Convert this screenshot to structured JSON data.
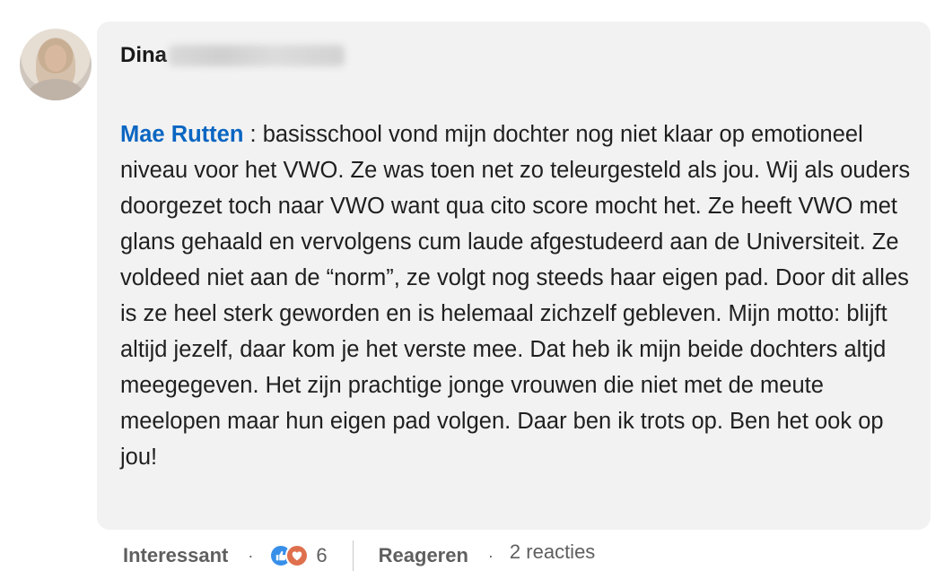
{
  "comment": {
    "author_first": "Dina",
    "mention": "Mae Rutten",
    "text": " : basisschool vond mijn dochter nog niet klaar op emotioneel niveau voor het VWO. Ze was toen net zo teleurgesteld als jou. Wij als ouders doorgezet toch naar VWO want qua cito score mocht het. Ze heeft VWO met glans gehaald en vervolgens cum laude afgestudeerd aan de Universiteit. Ze voldeed niet aan de “norm”, ze volgt nog steeds haar eigen pad. Door dit alles is ze heel sterk geworden en is helemaal zichzelf gebleven. Mijn motto: blijft altijd jezelf, daar kom je het verste mee. Dat heb ik mijn beide dochters altjd meegegeven. Het zijn prachtige jonge vrouwen die niet met de meute meelopen maar hun eigen pad volgen. Daar ben ik trots op. Ben het ook op jou!"
  },
  "actions": {
    "reaction_label": "Interessant",
    "separator": "·",
    "reaction_count": "6",
    "reply_label": "Reageren",
    "replies": "2 reacties"
  },
  "icons": {
    "like": "thumbs-up-icon",
    "love": "heart-icon"
  },
  "colors": {
    "mention": "#0a66c2",
    "like": "#378fe9",
    "love": "#df704d",
    "bubble": "#f2f2f2"
  }
}
